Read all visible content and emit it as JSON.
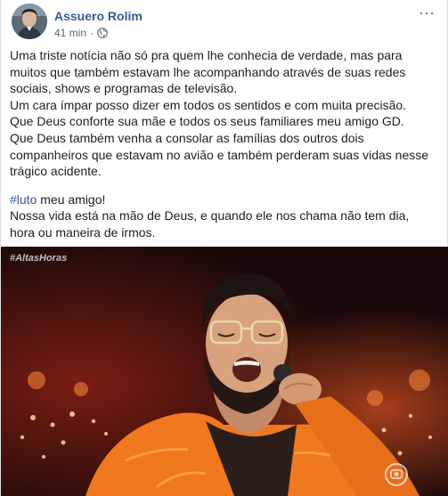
{
  "post": {
    "author": "Assuero Rolim",
    "time": "41 min",
    "separator": "·",
    "privacy_icon": "globe-icon",
    "more_icon": "more-options-icon",
    "text": {
      "line1": "Uma triste notícia não só pra quem lhe conhecia de verdade, mas para muitos que também estavam lhe acompanhando através de suas redes sociais, shows e programas de televisão.",
      "line2": "Um cara ímpar posso dizer em todos os sentidos e com muita precisão.",
      "line3": "Que Deus conforte sua mãe e todos os seus familiares meu amigo GD.",
      "line4": "Que Deus também venha a consolar as famílias dos outros dois companheiros que estavam no avião e também perderam suas vidas nesse trágico acidente.",
      "hashtag": "#luto",
      "line5_rest": " meu amigo!",
      "line6": "Nossa vida está na mão de Deus, e quando ele nos chama não tem dia, hora ou maneira de irmos."
    }
  },
  "video": {
    "watermark": "#AltasHoras",
    "channel_logo_icon": "tv-globo-logo-icon"
  },
  "colors": {
    "link": "#385898",
    "text": "#1c1e21",
    "meta": "#606770",
    "jacket": "#f0781e"
  }
}
